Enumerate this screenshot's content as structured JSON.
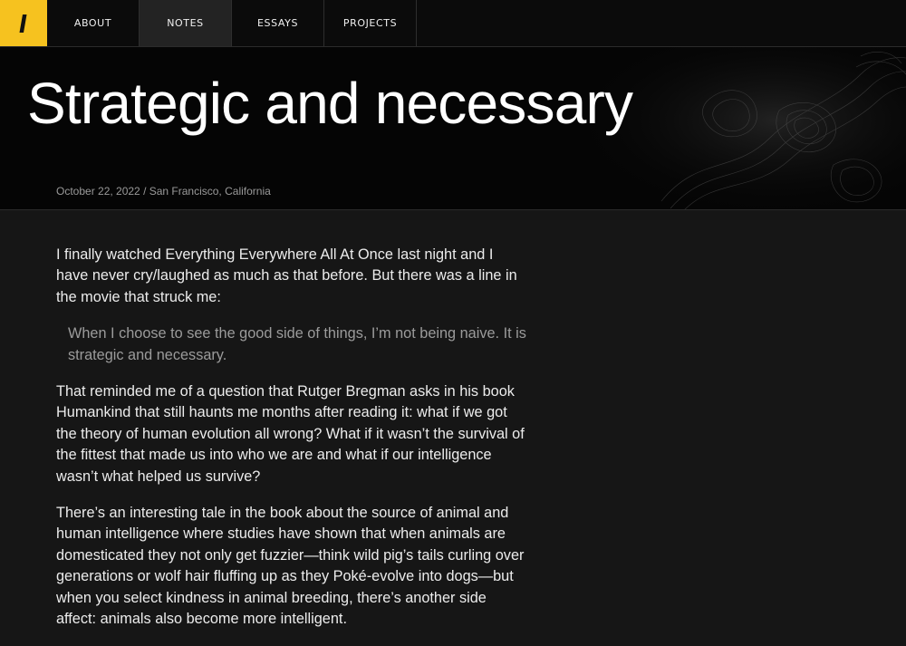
{
  "logo": {
    "glyph": "/"
  },
  "nav": [
    {
      "label": "ABOUT",
      "active": false
    },
    {
      "label": "NOTES",
      "active": true
    },
    {
      "label": "ESSAYS",
      "active": false
    },
    {
      "label": "PROJECTS",
      "active": false
    }
  ],
  "post": {
    "title": "Strategic and necessary",
    "meta": "October 22, 2022 / San Francisco, California"
  },
  "body": {
    "p1": "I finally watched Everything Everywhere All At Once last night and I have never cry/laughed as much as that before. But there was a line in the movie that struck me:",
    "quote": "When I choose to see the good side of things, I’m not being naive. It is strategic and necessary.",
    "p2": "That reminded me of a question that Rutger Bregman asks in his book Humankind that still haunts me months after reading it: what if we got the theory of human evolution all wrong? What if it wasn’t the survival of the fittest that made us into who we are and what if our intelligence wasn’t what helped us survive?",
    "p3": "There’s an interesting tale in the book about the source of animal and human intelligence where studies have shown that when animals are domesticated they not only get fuzzier—think wild pig’s tails curling over generations or wolf hair fluffing up as they Poké-evolve into dogs—but when you select kindness in animal breeding, there’s another side affect: animals also become more intelligent."
  },
  "colors": {
    "accent": "#f6c21f",
    "page_bg": "#161616",
    "hero_bg": "#050505",
    "nav_bg": "#0b0b0b",
    "nav_active_bg": "#232323",
    "quote_text": "#9b9b9b"
  }
}
